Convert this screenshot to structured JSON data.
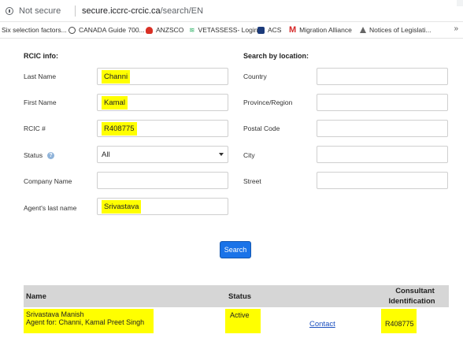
{
  "browser": {
    "secure_label": "Not secure",
    "url_host": "secure.iccrc-crcic.ca",
    "url_path": "/search/EN",
    "bookmarks": [
      {
        "label": "Six selection factors...",
        "icon": "none"
      },
      {
        "label": "CANADA Guide 700...",
        "icon": "globe-icon"
      },
      {
        "label": "ANZSCO",
        "icon": "red-blob-icon"
      },
      {
        "label": "VETASSESS- Login",
        "icon": "v-icon"
      },
      {
        "label": "ACS",
        "icon": "acs-shield-icon"
      },
      {
        "label": "Migration Alliance",
        "icon": "m-icon"
      },
      {
        "label": "Notices of Legislati...",
        "icon": "triangle-icon"
      }
    ],
    "more_label": "»"
  },
  "form": {
    "rcic_title": "RCIC info:",
    "location_title": "Search by location:",
    "last_name_label": "Last Name",
    "last_name_value": "Channi",
    "first_name_label": "First Name",
    "first_name_value": "Kamal",
    "rcic_label": "RCIC #",
    "rcic_value": "R408775",
    "status_label": "Status",
    "status_help": "?",
    "status_value": "All",
    "company_label": "Company Name",
    "company_value": "",
    "agent_label": "Agent's last name",
    "agent_value": "Srivastava",
    "country_label": "Country",
    "province_label": "Province/Region",
    "postal_label": "Postal Code",
    "city_label": "City",
    "street_label": "Street",
    "search_button": "Search"
  },
  "results": {
    "headers": {
      "name": "Name",
      "status": "Status",
      "consultant_line1": "Consultant",
      "consultant_line2": "Identification"
    },
    "rows": [
      {
        "name_line1": "Srivastava Manish",
        "name_line2": "Agent for: Channi, Kamal Preet Singh",
        "status": "Active",
        "contact": "Contact",
        "id": "R408775"
      }
    ]
  },
  "colors": {
    "highlight": "#ffff00",
    "button": "#1a73e8",
    "header_bg": "#d6d6d6",
    "link": "#1a4fbf"
  }
}
